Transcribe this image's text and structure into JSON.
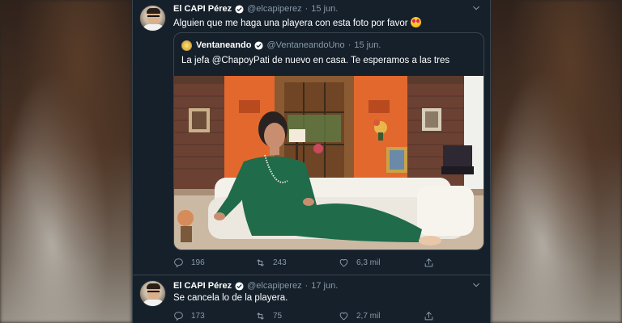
{
  "tweet1": {
    "name": "El CAPI Pérez",
    "handle": "@elcapiperez",
    "dot": "·",
    "date": "15 jun.",
    "text": "Alguien que me haga una playera con esta foto por favor",
    "emoji": "heart-eyes-emoji",
    "quote": {
      "name": "Ventaneando",
      "handle": "@VentaneandoUno",
      "dot": "·",
      "date": "15 jun.",
      "text": "La jefa @ChapoyPati de nuevo en casa. Te esperamos a las tres"
    },
    "actions": {
      "replies": "196",
      "retweets": "243",
      "likes": "6,3 mil"
    }
  },
  "tweet2": {
    "name": "El CAPI Pérez",
    "handle": "@elcapiperez",
    "dot": "·",
    "date": "17 jun.",
    "text": "Se cancela lo de la playera.",
    "actions": {
      "replies": "173",
      "retweets": "75",
      "likes": "2,7 mil"
    }
  },
  "colors": {
    "background": "#15202b",
    "border": "#38444d",
    "secondary_text": "#8899a6",
    "verified": "#1da1f2"
  }
}
